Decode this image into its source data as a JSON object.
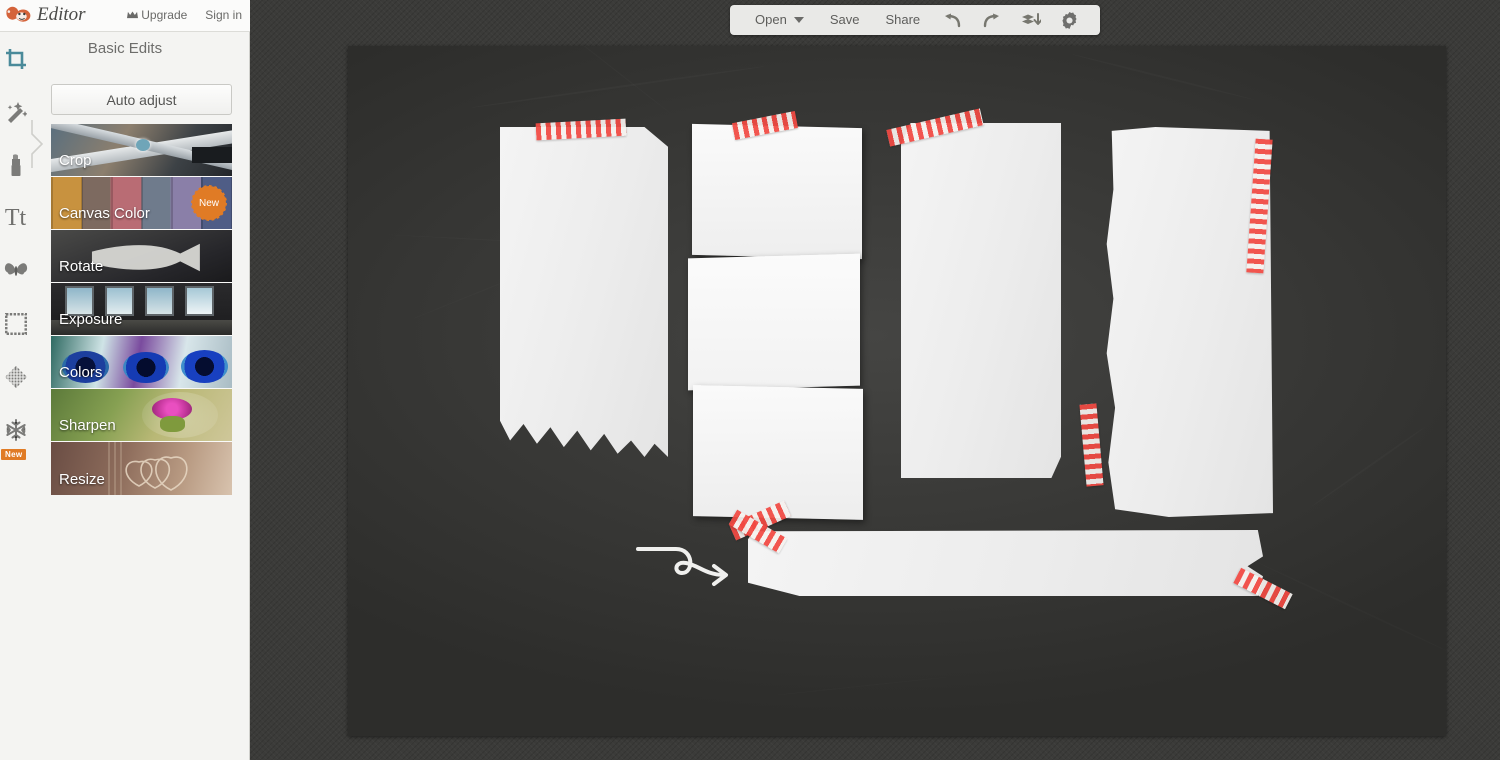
{
  "app": {
    "brand_name": "Editor",
    "logo_icon": "monkey-logo-icon",
    "accent_color": "#e07b25",
    "rail_active_color": "#4a8a9a"
  },
  "header": {
    "upgrade_label": "Upgrade",
    "upgrade_icon": "crown-icon",
    "signin_label": "Sign in"
  },
  "sidebar": {
    "panel_title": "Basic Edits",
    "auto_adjust_label": "Auto adjust",
    "collapse_handle_icon": "chevron-right-icon",
    "items": [
      {
        "label": "Crop",
        "badge": "",
        "icon": "crop-thumbnail"
      },
      {
        "label": "Canvas Color",
        "badge": "New",
        "icon": "canvas-color-thumbnail"
      },
      {
        "label": "Rotate",
        "badge": "",
        "icon": "rotate-thumbnail"
      },
      {
        "label": "Exposure",
        "badge": "",
        "icon": "exposure-thumbnail"
      },
      {
        "label": "Colors",
        "badge": "",
        "icon": "colors-thumbnail"
      },
      {
        "label": "Sharpen",
        "badge": "",
        "icon": "sharpen-thumbnail"
      },
      {
        "label": "Resize",
        "badge": "",
        "icon": "resize-thumbnail"
      }
    ]
  },
  "rail": {
    "items": [
      {
        "name": "crop-tool",
        "icon": "crop-icon",
        "active": true,
        "badge": ""
      },
      {
        "name": "effects-tool",
        "icon": "magic-wand-icon",
        "active": false,
        "badge": ""
      },
      {
        "name": "touchup-tool",
        "icon": "lipstick-icon",
        "active": false,
        "badge": ""
      },
      {
        "name": "text-tool",
        "icon": "text-tt-icon",
        "active": false,
        "badge": ""
      },
      {
        "name": "overlays-tool",
        "icon": "butterfly-icon",
        "active": false,
        "badge": ""
      },
      {
        "name": "frames-tool",
        "icon": "frame-icon",
        "active": false,
        "badge": ""
      },
      {
        "name": "textures-tool",
        "icon": "texture-icon",
        "active": false,
        "badge": ""
      },
      {
        "name": "themes-tool",
        "icon": "snowflake-icon",
        "active": false,
        "badge": "New"
      }
    ]
  },
  "toolbar": {
    "open_label": "Open",
    "open_caret_icon": "chevron-down-icon",
    "save_label": "Save",
    "share_label": "Share",
    "undo_icon": "undo-arrow-icon",
    "redo_icon": "redo-arrow-icon",
    "layers_icon": "layers-download-icon",
    "settings_icon": "gear-icon"
  },
  "canvas": {
    "description": "chalkboard background with taped paper sheets",
    "background_color": "#343432",
    "tape_color": "#f24a43",
    "paper_color": "#efefef",
    "doodle_icon": "curly-arrow-doodle"
  }
}
